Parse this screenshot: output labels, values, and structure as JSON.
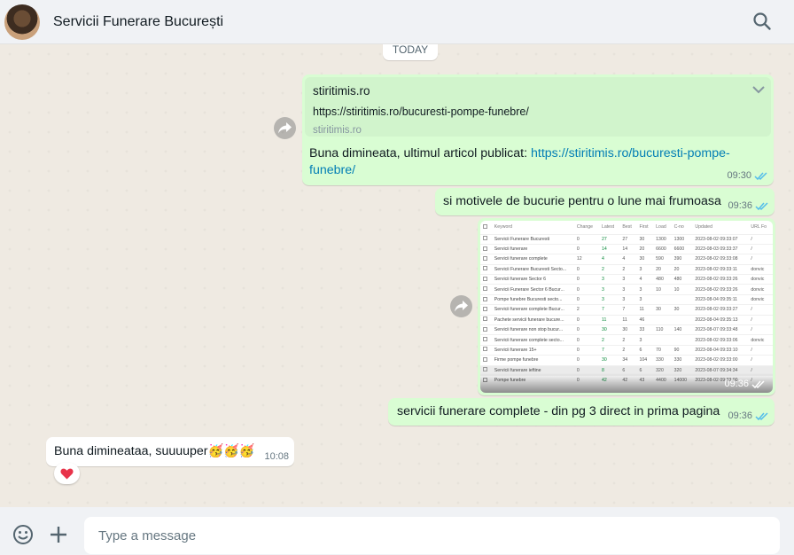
{
  "header": {
    "contact_name": "Servicii Funerare București"
  },
  "chat": {
    "day_label": "TODAY",
    "messages": [
      {
        "link_preview": {
          "title": "stiritimis.ro",
          "url": "https://stiritimis.ro/bucuresti-pompe-funebre/",
          "domain": "stiritimis.ro"
        },
        "text": "Buna dimineata, ultimul articol publicat: ",
        "link_text": "https://stiritimis.ro/bucuresti-pompe-funebre/",
        "time": "09:30"
      },
      {
        "text": "si motivele de bucurie pentru o lune mai frumoasa",
        "time": "09:36"
      },
      {
        "image": {
          "columns": [
            "Keyword",
            "Change",
            "Latest",
            "Best",
            "First",
            "Load",
            "C-no",
            "Updated",
            "URL Fo"
          ],
          "rows": [
            [
              "Servicii Funerare Bucuresti",
              "0",
              "27",
              "27",
              "30",
              "1300",
              "1300",
              "2023-08-02 09:33:07",
              "/"
            ],
            [
              "Servicii funerare",
              "0",
              "14",
              "14",
              "20",
              "6600",
              "6600",
              "2023-08-03 09:33:37",
              "/"
            ],
            [
              "Servicii funerare complete",
              "12",
              "4",
              "4",
              "30",
              "590",
              "390",
              "2023-08-02 09:33:08",
              "/"
            ],
            [
              "Servicii Funerare Bucuresti Secto...",
              "0",
              "2",
              "2",
              "3",
              "20",
              "20",
              "2023-08-02 09:33:11",
              "donvic"
            ],
            [
              "Servicii funerare Sector 6",
              "0",
              "3",
              "3",
              "4",
              "480",
              "480",
              "2023-08-02 09:33:26",
              "donvic"
            ],
            [
              "Servicii Funerare Sector 6 Bucur...",
              "0",
              "3",
              "3",
              "3",
              "10",
              "10",
              "2023-08-02 09:33:26",
              "donvic"
            ],
            [
              "Pompe funebre Bucuresti secto...",
              "0",
              "3",
              "3",
              "3",
              "",
              "",
              "2023-08-04 09:35:11",
              "donvic"
            ],
            [
              "Servicii funerare complete Bucur...",
              "2",
              "7",
              "7",
              "11",
              "30",
              "30",
              "2023-08-02 09:33:27",
              "/"
            ],
            [
              "Pachete servicii funerare bucure...",
              "0",
              "11",
              "11",
              "46",
              "",
              "",
              "2023-08-04 09:35:13",
              "/"
            ],
            [
              "Servicii funerare non stop bucur...",
              "0",
              "30",
              "30",
              "33",
              "110",
              "140",
              "2023-08-07 09:33:48",
              "/"
            ],
            [
              "Servicii funerare complete secto...",
              "0",
              "2",
              "2",
              "3",
              "",
              "",
              "2023-08-02 09:33:06",
              "donvic"
            ],
            [
              "Servicii funerare 15+",
              "0",
              "7",
              "2",
              "6",
              "70",
              "90",
              "2023-08-04 09:33:10",
              "/"
            ],
            [
              "Firme pompe funebre",
              "0",
              "30",
              "34",
              "104",
              "330",
              "330",
              "2023-08-02 09:33:00",
              "/"
            ],
            [
              "Servicii funerare ieftine",
              "0",
              "8",
              "6",
              "6",
              "320",
              "320",
              "2023-08-07 09:34:34",
              "/"
            ],
            [
              "Pompe funebre",
              "0",
              "42",
              "42",
              "43",
              "4400",
              "14000",
              "2023-08-02 09:33:00",
              "/"
            ]
          ]
        },
        "time": "09:36"
      },
      {
        "text": "servicii funerare complete - din pg 3 direct in prima pagina",
        "time": "09:36"
      },
      {
        "text": "Buna dimineataa, suuuuper🥳🥳🥳",
        "time": "10:08",
        "reaction": "❤️"
      }
    ]
  },
  "composer": {
    "placeholder": "Type a message"
  },
  "icons": [
    "search-icon",
    "forward-icon",
    "chevron-down-icon",
    "double-check-icon",
    "smiley-icon",
    "plus-icon",
    "heart-icon"
  ],
  "colors": {
    "outgoing": "#d9fdd3",
    "incoming": "#ffffff",
    "read_ticks": "#53bdeb",
    "link": "#027eb5",
    "chat_bg": "#efeae2"
  }
}
